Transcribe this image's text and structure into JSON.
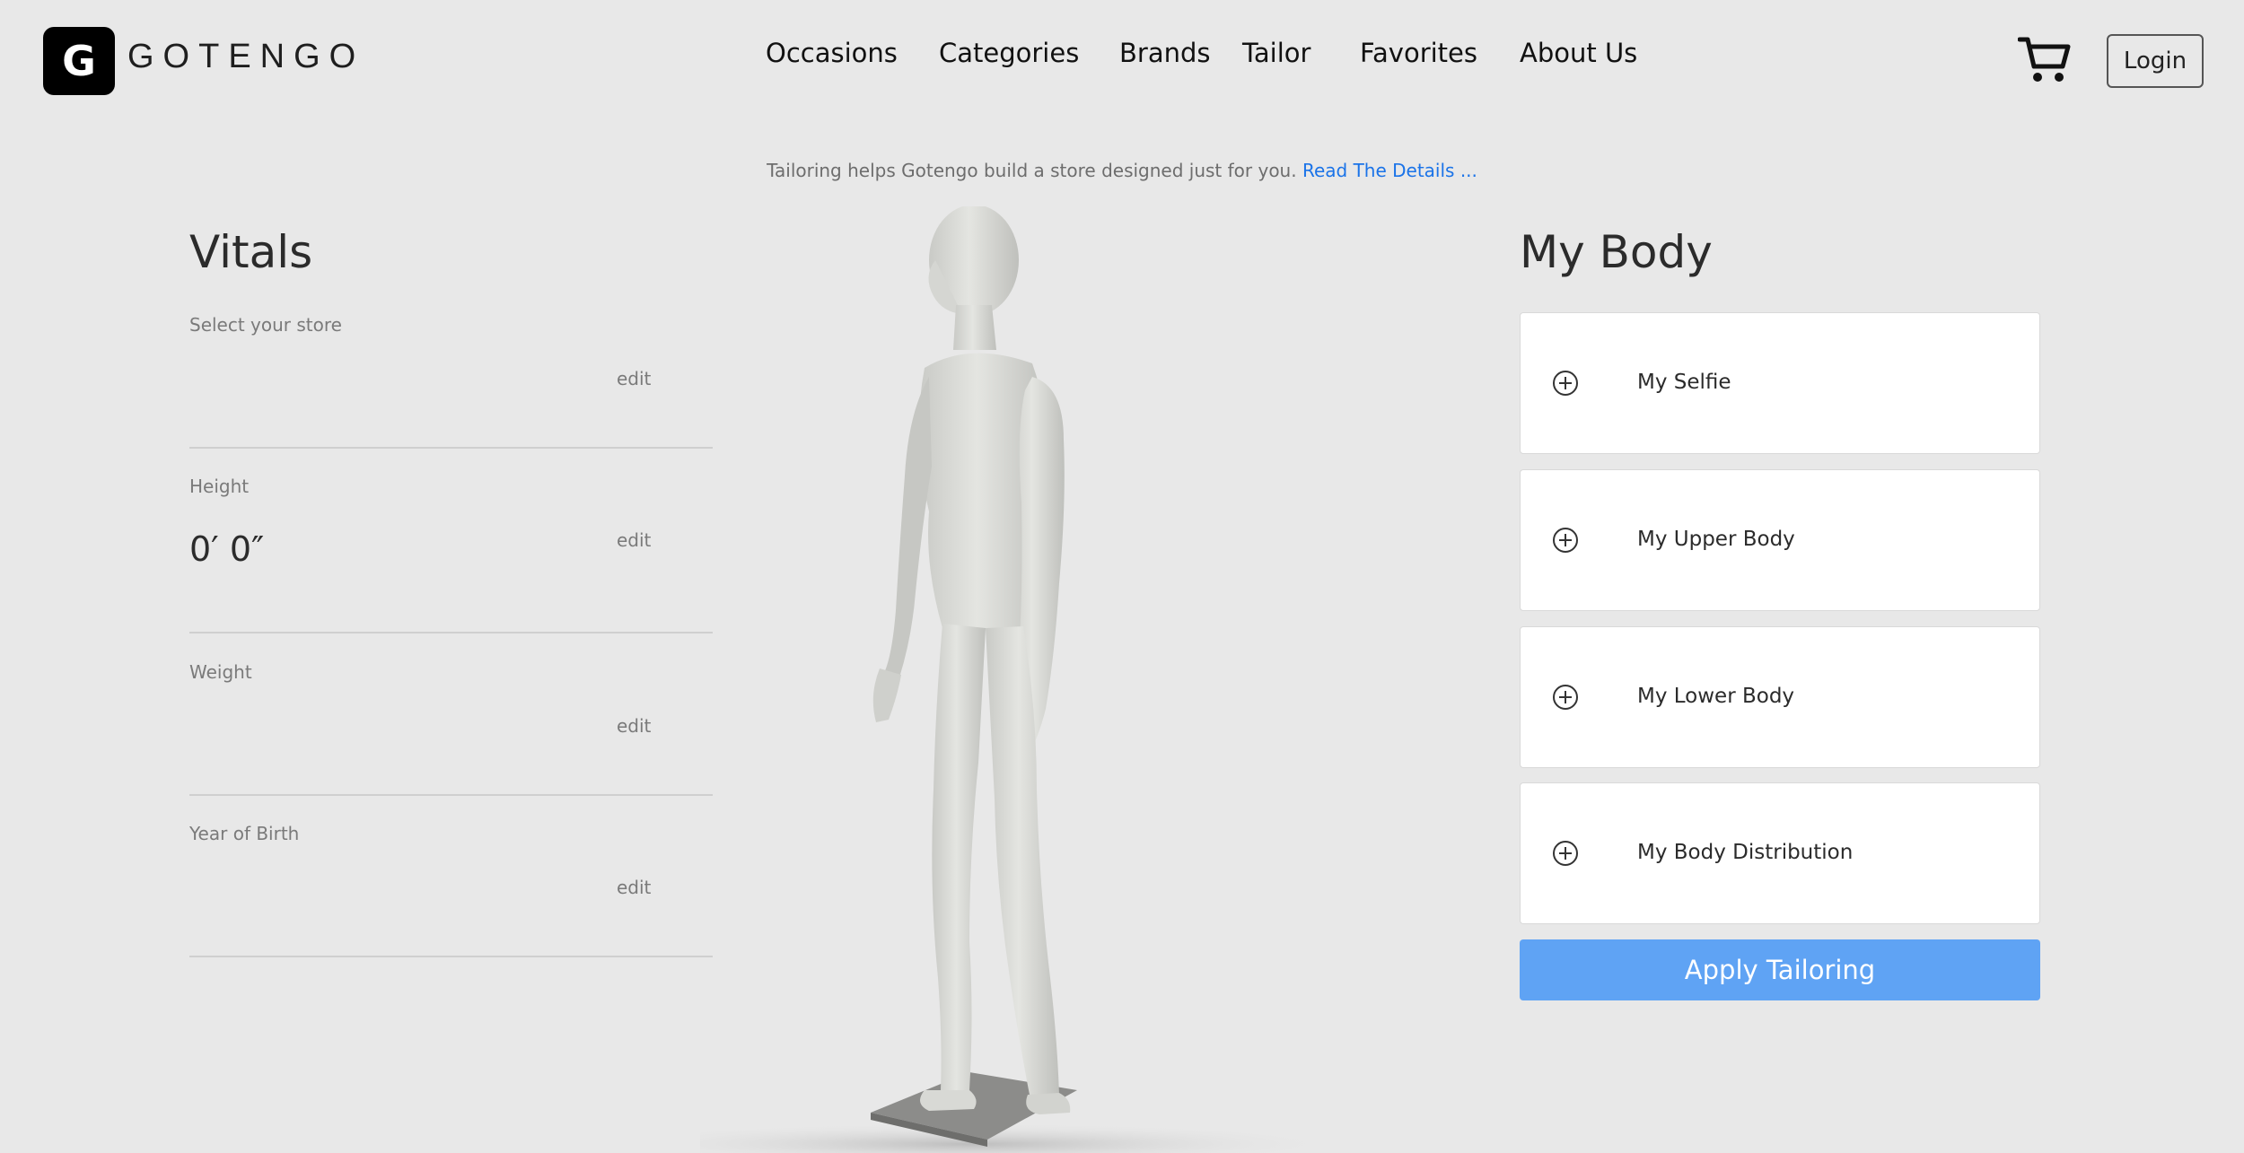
{
  "header": {
    "logo_letter": "G",
    "brand": "GOTENGO",
    "nav": [
      "Occasions",
      "Categories",
      "Brands",
      "Tailor",
      "Favorites",
      "About Us"
    ],
    "login_label": "Login"
  },
  "tagline": {
    "text": "Tailoring helps Gotengo build a store designed just for you.",
    "link": "Read The Details ..."
  },
  "vitals": {
    "title": "Vitals",
    "store": {
      "label": "Select your store",
      "value": "",
      "edit": "edit"
    },
    "height": {
      "label": "Height",
      "value": "0′ 0″",
      "edit": "edit"
    },
    "weight": {
      "label": "Weight",
      "value": "",
      "edit": "edit"
    },
    "birth": {
      "label": "Year of Birth",
      "value": "",
      "edit": "edit"
    }
  },
  "body": {
    "title": "My Body",
    "cards": [
      "My Selfie",
      "My Upper Body",
      "My Lower Body",
      "My Body Distribution"
    ],
    "apply_label": "Apply Tailoring"
  },
  "colors": {
    "background": "#e8e8e8",
    "link": "#1a73e8",
    "apply_button": "#5fa3f4"
  }
}
